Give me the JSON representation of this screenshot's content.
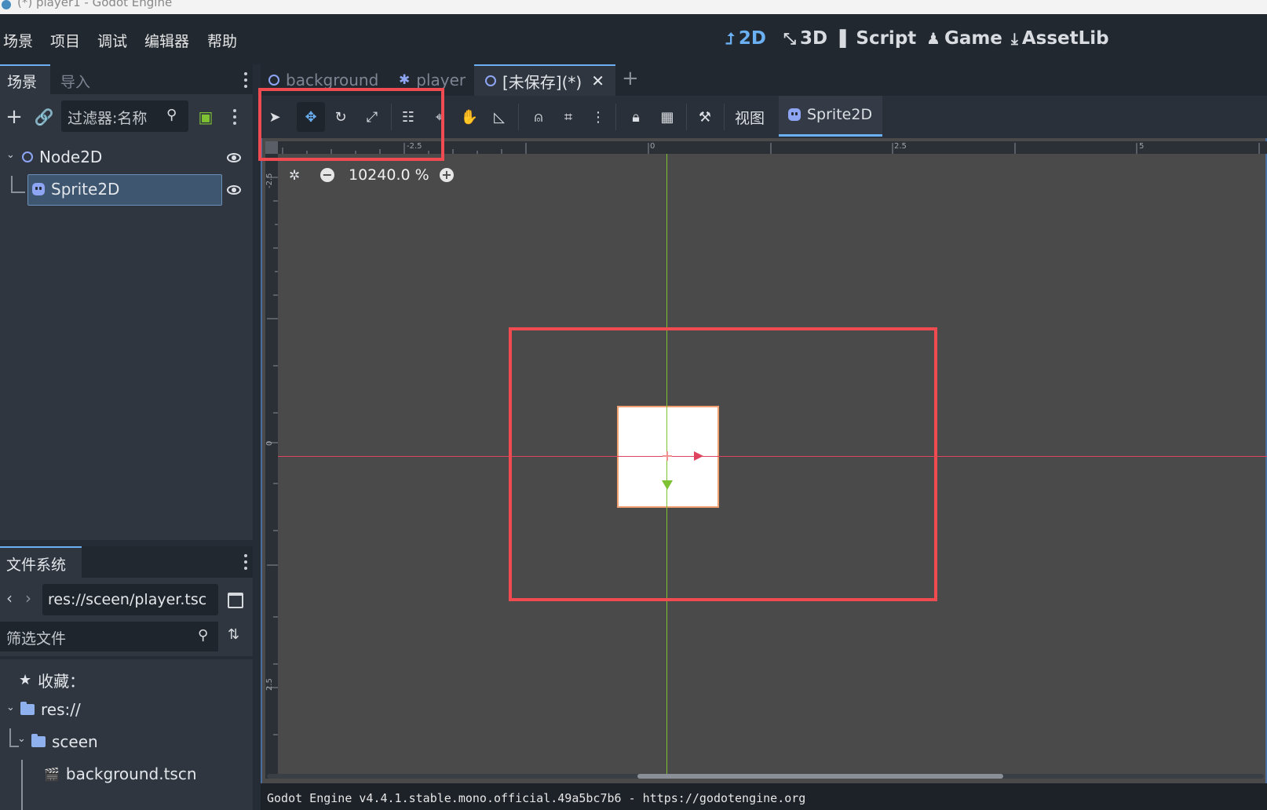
{
  "window": {
    "title": "(*) player1 - Godot Engine"
  },
  "menu": {
    "items": [
      "场景",
      "项目",
      "调试",
      "编辑器",
      "帮助"
    ]
  },
  "workspaces": [
    {
      "label": "2D",
      "icon": "2d-icon",
      "active": true
    },
    {
      "label": "3D",
      "icon": "3d-icon",
      "active": false
    },
    {
      "label": "Script",
      "icon": "script-icon",
      "active": false
    },
    {
      "label": "Game",
      "icon": "game-icon",
      "active": false
    },
    {
      "label": "AssetLib",
      "icon": "assetlib-icon",
      "active": false
    }
  ],
  "scene_dock": {
    "tabs": [
      "场景",
      "导入"
    ],
    "filter_placeholder": "过滤器:名称",
    "tree": [
      {
        "label": "Node2D",
        "type": "Node2D"
      },
      {
        "label": "Sprite2D",
        "type": "Sprite2D",
        "selected": true
      }
    ]
  },
  "filesystem_dock": {
    "tab": "文件系统",
    "path": "res://sceen/player.tsc",
    "filter_placeholder": "筛选文件",
    "favorites_label": "收藏：",
    "tree": [
      {
        "label": "res://"
      },
      {
        "label": "sceen"
      },
      {
        "label": "background.tscn"
      }
    ]
  },
  "scene_tabs": [
    {
      "label": "background",
      "active": false
    },
    {
      "label": "player",
      "active": false
    },
    {
      "label": "[未保存](*)",
      "active": true
    }
  ],
  "toolbar": {
    "view_menu": "视图",
    "sprite_menu": "Sprite2D",
    "active_tool": "move"
  },
  "viewport": {
    "zoom": "10240.0 %",
    "ruler_h_labels": [
      "-2.5",
      "0",
      "2.5",
      "5"
    ],
    "ruler_v_labels": [
      "-2.5",
      "0",
      "2.5"
    ]
  },
  "status": {
    "text": "Godot Engine v4.4.1.stable.mono.official.49a5bc7b6 - https://godotengine.org"
  },
  "colors": {
    "accent": "#6ab0f3",
    "annotation_red": "#ef4b51",
    "x_axis": "#e0435f",
    "y_axis": "#7ec234"
  }
}
